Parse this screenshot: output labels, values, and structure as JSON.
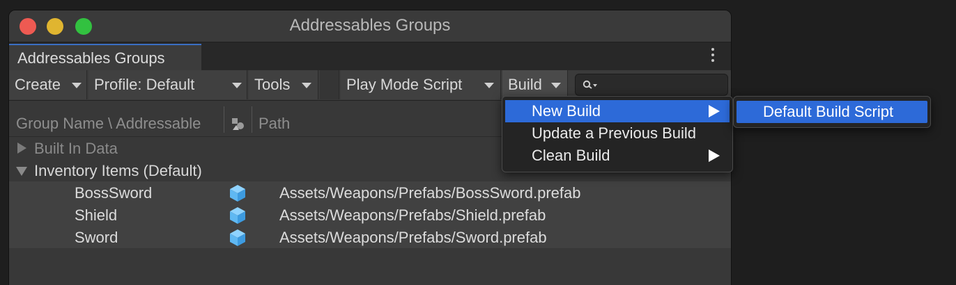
{
  "window": {
    "title": "Addressables Groups"
  },
  "tab": {
    "label": "Addressables Groups"
  },
  "toolbar": {
    "create": "Create",
    "profile": "Profile: Default",
    "tools": "Tools",
    "play_mode": "Play Mode Script",
    "build": "Build",
    "search_placeholder": ""
  },
  "columns": {
    "name": "Group Name \\ Addressable",
    "path": "Path"
  },
  "groups": [
    {
      "label": "Built In Data",
      "expanded": false
    },
    {
      "label": "Inventory Items (Default)",
      "expanded": true
    }
  ],
  "entries": [
    {
      "name": "BossSword",
      "path": "Assets/Weapons/Prefabs/BossSword.prefab"
    },
    {
      "name": "Shield",
      "path": "Assets/Weapons/Prefabs/Shield.prefab"
    },
    {
      "name": "Sword",
      "path": "Assets/Weapons/Prefabs/Sword.prefab"
    }
  ],
  "build_menu": {
    "items": [
      {
        "label": "New Build",
        "has_submenu": true,
        "active": true
      },
      {
        "label": "Update a Previous Build",
        "has_submenu": false,
        "active": false
      },
      {
        "label": "Clean Build",
        "has_submenu": true,
        "active": false
      }
    ],
    "submenu": [
      {
        "label": "Default Build Script"
      }
    ]
  },
  "colors": {
    "accent": "#2d6ad8",
    "prefab_icon": "#5fb8f2"
  }
}
